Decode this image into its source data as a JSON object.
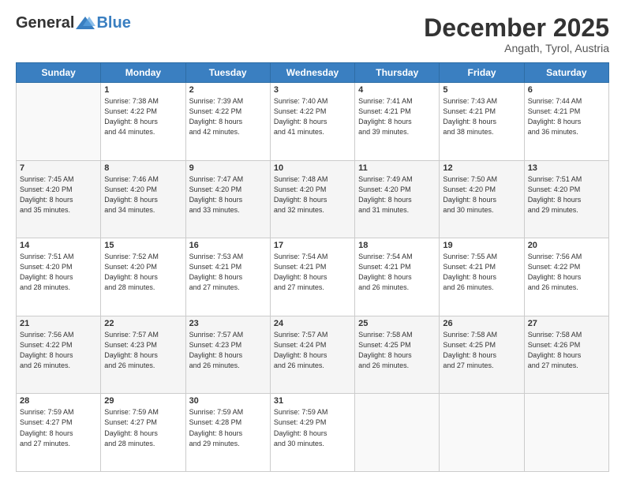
{
  "logo": {
    "general": "General",
    "blue": "Blue"
  },
  "title": "December 2025",
  "location": "Angath, Tyrol, Austria",
  "days_of_week": [
    "Sunday",
    "Monday",
    "Tuesday",
    "Wednesday",
    "Thursday",
    "Friday",
    "Saturday"
  ],
  "weeks": [
    [
      {
        "day": "",
        "info": ""
      },
      {
        "day": "1",
        "info": "Sunrise: 7:38 AM\nSunset: 4:22 PM\nDaylight: 8 hours\nand 44 minutes."
      },
      {
        "day": "2",
        "info": "Sunrise: 7:39 AM\nSunset: 4:22 PM\nDaylight: 8 hours\nand 42 minutes."
      },
      {
        "day": "3",
        "info": "Sunrise: 7:40 AM\nSunset: 4:22 PM\nDaylight: 8 hours\nand 41 minutes."
      },
      {
        "day": "4",
        "info": "Sunrise: 7:41 AM\nSunset: 4:21 PM\nDaylight: 8 hours\nand 39 minutes."
      },
      {
        "day": "5",
        "info": "Sunrise: 7:43 AM\nSunset: 4:21 PM\nDaylight: 8 hours\nand 38 minutes."
      },
      {
        "day": "6",
        "info": "Sunrise: 7:44 AM\nSunset: 4:21 PM\nDaylight: 8 hours\nand 36 minutes."
      }
    ],
    [
      {
        "day": "7",
        "info": "Sunrise: 7:45 AM\nSunset: 4:20 PM\nDaylight: 8 hours\nand 35 minutes."
      },
      {
        "day": "8",
        "info": "Sunrise: 7:46 AM\nSunset: 4:20 PM\nDaylight: 8 hours\nand 34 minutes."
      },
      {
        "day": "9",
        "info": "Sunrise: 7:47 AM\nSunset: 4:20 PM\nDaylight: 8 hours\nand 33 minutes."
      },
      {
        "day": "10",
        "info": "Sunrise: 7:48 AM\nSunset: 4:20 PM\nDaylight: 8 hours\nand 32 minutes."
      },
      {
        "day": "11",
        "info": "Sunrise: 7:49 AM\nSunset: 4:20 PM\nDaylight: 8 hours\nand 31 minutes."
      },
      {
        "day": "12",
        "info": "Sunrise: 7:50 AM\nSunset: 4:20 PM\nDaylight: 8 hours\nand 30 minutes."
      },
      {
        "day": "13",
        "info": "Sunrise: 7:51 AM\nSunset: 4:20 PM\nDaylight: 8 hours\nand 29 minutes."
      }
    ],
    [
      {
        "day": "14",
        "info": "Sunrise: 7:51 AM\nSunset: 4:20 PM\nDaylight: 8 hours\nand 28 minutes."
      },
      {
        "day": "15",
        "info": "Sunrise: 7:52 AM\nSunset: 4:20 PM\nDaylight: 8 hours\nand 28 minutes."
      },
      {
        "day": "16",
        "info": "Sunrise: 7:53 AM\nSunset: 4:21 PM\nDaylight: 8 hours\nand 27 minutes."
      },
      {
        "day": "17",
        "info": "Sunrise: 7:54 AM\nSunset: 4:21 PM\nDaylight: 8 hours\nand 27 minutes."
      },
      {
        "day": "18",
        "info": "Sunrise: 7:54 AM\nSunset: 4:21 PM\nDaylight: 8 hours\nand 26 minutes."
      },
      {
        "day": "19",
        "info": "Sunrise: 7:55 AM\nSunset: 4:21 PM\nDaylight: 8 hours\nand 26 minutes."
      },
      {
        "day": "20",
        "info": "Sunrise: 7:56 AM\nSunset: 4:22 PM\nDaylight: 8 hours\nand 26 minutes."
      }
    ],
    [
      {
        "day": "21",
        "info": "Sunrise: 7:56 AM\nSunset: 4:22 PM\nDaylight: 8 hours\nand 26 minutes."
      },
      {
        "day": "22",
        "info": "Sunrise: 7:57 AM\nSunset: 4:23 PM\nDaylight: 8 hours\nand 26 minutes."
      },
      {
        "day": "23",
        "info": "Sunrise: 7:57 AM\nSunset: 4:23 PM\nDaylight: 8 hours\nand 26 minutes."
      },
      {
        "day": "24",
        "info": "Sunrise: 7:57 AM\nSunset: 4:24 PM\nDaylight: 8 hours\nand 26 minutes."
      },
      {
        "day": "25",
        "info": "Sunrise: 7:58 AM\nSunset: 4:25 PM\nDaylight: 8 hours\nand 26 minutes."
      },
      {
        "day": "26",
        "info": "Sunrise: 7:58 AM\nSunset: 4:25 PM\nDaylight: 8 hours\nand 27 minutes."
      },
      {
        "day": "27",
        "info": "Sunrise: 7:58 AM\nSunset: 4:26 PM\nDaylight: 8 hours\nand 27 minutes."
      }
    ],
    [
      {
        "day": "28",
        "info": "Sunrise: 7:59 AM\nSunset: 4:27 PM\nDaylight: 8 hours\nand 27 minutes."
      },
      {
        "day": "29",
        "info": "Sunrise: 7:59 AM\nSunset: 4:27 PM\nDaylight: 8 hours\nand 28 minutes."
      },
      {
        "day": "30",
        "info": "Sunrise: 7:59 AM\nSunset: 4:28 PM\nDaylight: 8 hours\nand 29 minutes."
      },
      {
        "day": "31",
        "info": "Sunrise: 7:59 AM\nSunset: 4:29 PM\nDaylight: 8 hours\nand 30 minutes."
      },
      {
        "day": "",
        "info": ""
      },
      {
        "day": "",
        "info": ""
      },
      {
        "day": "",
        "info": ""
      }
    ]
  ]
}
